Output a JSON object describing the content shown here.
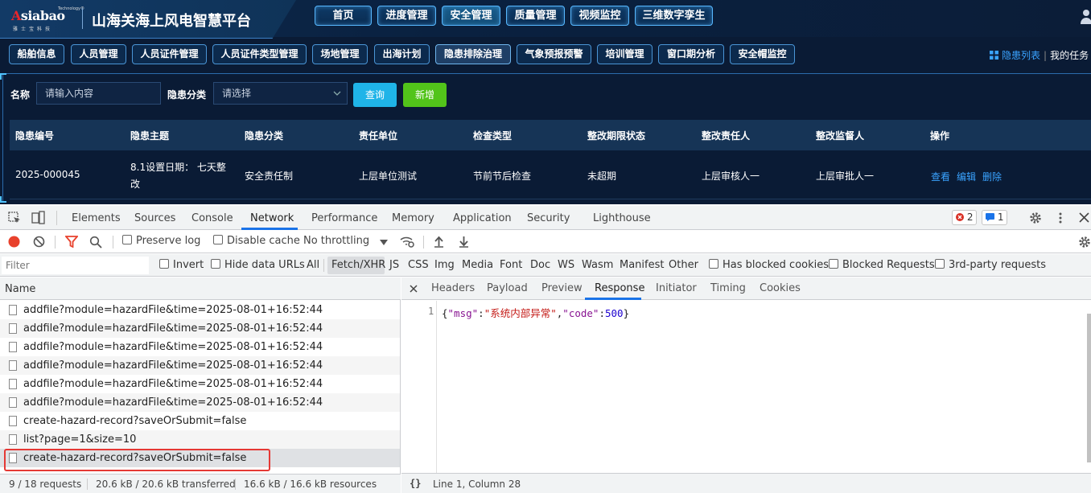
{
  "app": {
    "logo_main": "siabao",
    "logo_initial": "A",
    "logo_small": "Technology®",
    "logo_sub": "雅士宝科技",
    "title": "山海关海上风电智慧平台",
    "nav": [
      {
        "label": "首页"
      },
      {
        "label": "进度管理"
      },
      {
        "label": "安全管理"
      },
      {
        "label": "质量管理"
      },
      {
        "label": "视频监控"
      },
      {
        "label": "三维数字孪生"
      }
    ],
    "subnav": [
      {
        "label": "船舶信息"
      },
      {
        "label": "人员管理"
      },
      {
        "label": "人员证件管理"
      },
      {
        "label": "人员证件类型管理"
      },
      {
        "label": "场地管理"
      },
      {
        "label": "出海计划"
      },
      {
        "label": "隐患排除治理"
      },
      {
        "label": "气象预报预警"
      },
      {
        "label": "培训管理"
      },
      {
        "label": "窗口期分析"
      },
      {
        "label": "安全帽监控"
      }
    ],
    "crumb": {
      "current": "隐患列表",
      "sep": "|",
      "next": "我的任务"
    },
    "search": {
      "name_label": "名称",
      "name_placeholder": "请输入内容",
      "type_label": "隐患分类",
      "type_placeholder": "请选择",
      "query_btn": "查询",
      "add_btn": "新增"
    },
    "table": {
      "headers": [
        "隐患编号",
        "隐患主题",
        "隐患分类",
        "责任单位",
        "检查类型",
        "整改期限状态",
        "整改责任人",
        "整改监督人",
        "操作"
      ],
      "rows": [
        {
          "id": "2025-000045",
          "topic1": "8.1设置日期： 七天整",
          "topic2": "改",
          "type": "安全责任制",
          "unit": "上层单位测试",
          "check": "节前节后检查",
          "status": "未超期",
          "owner": "上层审核人一",
          "supervisor": "上层审批人一",
          "ops": [
            "查看",
            "编辑",
            "删除"
          ]
        }
      ]
    },
    "colors": {
      "accent": "#3aa3ff",
      "query": "#1fb4e8",
      "add": "#52c41a",
      "bg": "#0a1b35"
    }
  },
  "devtools": {
    "tabs": [
      "Elements",
      "Sources",
      "Console",
      "Network",
      "Performance",
      "Memory",
      "Application",
      "Security",
      "Lighthouse"
    ],
    "errors": "2",
    "messages": "1",
    "toolbar": {
      "preserve_log": "Preserve log",
      "disable_cache": "Disable cache",
      "throttling": "No throttling"
    },
    "filter": {
      "placeholder": "Filter",
      "invert": "Invert",
      "hide_urls": "Hide data URLs",
      "types": [
        "All",
        "Fetch/XHR",
        "JS",
        "CSS",
        "Img",
        "Media",
        "Font",
        "Doc",
        "WS",
        "Wasm",
        "Manifest",
        "Other"
      ],
      "blocked_cookies": "Has blocked cookies",
      "blocked_requests": "Blocked Requests",
      "third_party": "3rd-party requests"
    },
    "list_header": "Name",
    "requests": [
      "addfile?module=hazardFile&time=2025-08-01+16:52:44",
      "addfile?module=hazardFile&time=2025-08-01+16:52:44",
      "addfile?module=hazardFile&time=2025-08-01+16:52:44",
      "addfile?module=hazardFile&time=2025-08-01+16:52:44",
      "addfile?module=hazardFile&time=2025-08-01+16:52:44",
      "addfile?module=hazardFile&time=2025-08-01+16:52:44",
      "create-hazard-record?saveOrSubmit=false",
      "list?page=1&size=10",
      "create-hazard-record?saveOrSubmit=false"
    ],
    "resp_tabs": [
      "Headers",
      "Payload",
      "Preview",
      "Response",
      "Initiator",
      "Timing",
      "Cookies"
    ],
    "line_no": "1",
    "response": {
      "k1": "\"msg\"",
      "v1": "\"系统内部异常\"",
      "k2": "\"code\"",
      "v2": "500",
      "open": "{",
      "colon": ":",
      "comma": ",",
      "close": "}"
    },
    "resp_status": "Line 1, Column 28",
    "braces": "{}",
    "status": {
      "requests": "9 / 18 requests",
      "transferred": "20.6 kB / 20.6 kB transferred",
      "resources": "16.6 kB / 16.6 kB resources"
    }
  }
}
